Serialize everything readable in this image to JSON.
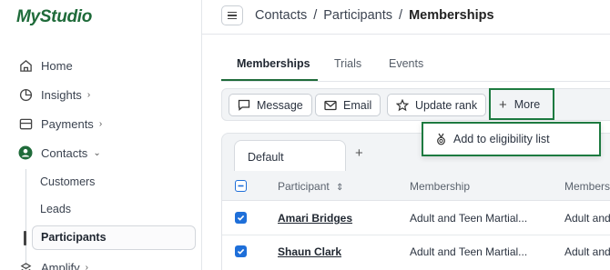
{
  "app": {
    "name": "MyStudio",
    "brand_color": "#1f6b3a"
  },
  "sidebar": {
    "items": [
      {
        "label": "Home",
        "icon": "home-icon"
      },
      {
        "label": "Insights",
        "icon": "pie-chart-icon",
        "expander": "chevron-right-icon"
      },
      {
        "label": "Payments",
        "icon": "payments-icon",
        "expander": "chevron-right-icon"
      },
      {
        "label": "Contacts",
        "icon": "user-circle-icon",
        "expander": "chevron-down-icon"
      },
      {
        "label": "Amplify",
        "icon": "amplify-icon",
        "expander": "chevron-right-icon"
      }
    ],
    "sub_items": [
      {
        "label": "Customers"
      },
      {
        "label": "Leads"
      },
      {
        "label": "Participants",
        "active": true
      }
    ]
  },
  "header": {
    "menu_icon": "hamburger-icon",
    "breadcrumb": [
      "Contacts",
      "Participants",
      "Memberships"
    ],
    "separator": "/"
  },
  "tabs": [
    {
      "label": "Memberships",
      "active": true
    },
    {
      "label": "Trials"
    },
    {
      "label": "Events"
    }
  ],
  "toolbar": {
    "message_label": "Message",
    "email_label": "Email",
    "update_rank_label": "Update rank",
    "more_label": "More"
  },
  "dropdown": {
    "items": [
      {
        "label": "Add to eligibility list",
        "icon": "medal-icon"
      }
    ]
  },
  "views": {
    "active": "Default",
    "add_label": "+"
  },
  "table": {
    "columns": [
      "Participant",
      "Membership",
      "Membersh"
    ],
    "rows": [
      {
        "checked": true,
        "participant": "Amari Bridges",
        "membership": "Adult and Teen Martial...",
        "membership2": "Adult and"
      },
      {
        "checked": true,
        "participant": "Shaun Clark",
        "membership": "Adult and Teen Martial...",
        "membership2": "Adult and"
      }
    ]
  },
  "colors": {
    "checkbox": "#1e6fd9",
    "highlight": "#1d7a40"
  }
}
